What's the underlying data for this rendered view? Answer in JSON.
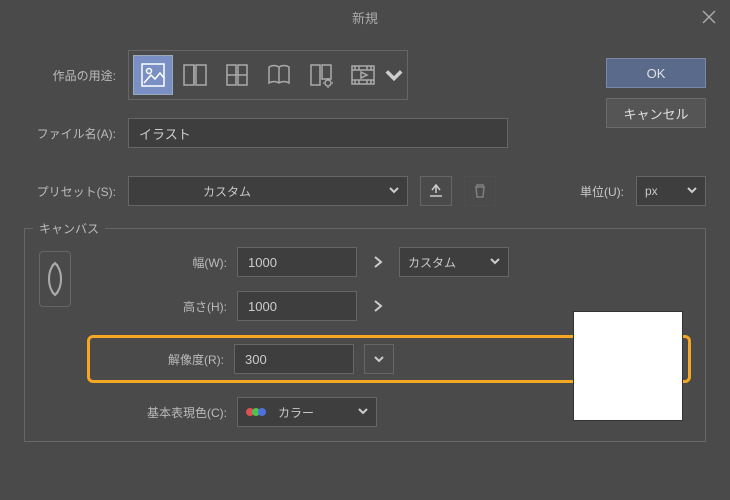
{
  "title": "新規",
  "buttons": {
    "ok": "OK",
    "cancel": "キャンセル"
  },
  "labels": {
    "purpose": "作品の用途:",
    "filename": "ファイル名(A):",
    "preset": "プリセット(S):",
    "unit": "単位(U):",
    "canvas": "キャンバス",
    "width": "幅(W):",
    "height": "高さ(H):",
    "resolution": "解像度(R):",
    "basecolor": "基本表現色(C):"
  },
  "values": {
    "filename": "イラスト",
    "preset": "カスタム",
    "unit": "px",
    "width": "1000",
    "height": "1000",
    "resolution": "300",
    "sizepreset": "カスタム",
    "colormode": "カラー"
  }
}
